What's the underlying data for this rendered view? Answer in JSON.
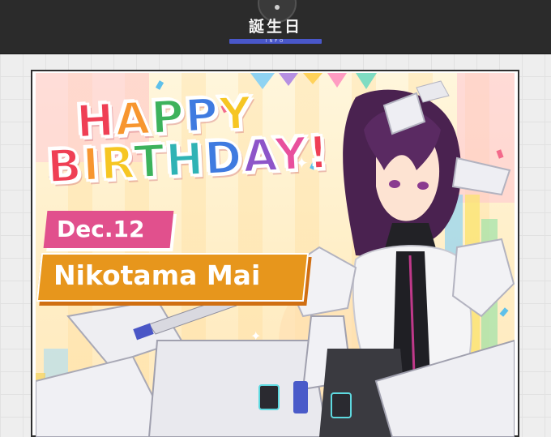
{
  "header": {
    "title": "誕生日",
    "subtitle": "INFO"
  },
  "banner": {
    "headline_line1": [
      "H",
      "A",
      "P",
      "P",
      "Y"
    ],
    "headline_line2": [
      "B",
      "I",
      "R",
      "T",
      "H",
      "D",
      "A",
      "Y",
      "!"
    ],
    "date": "Dec.12",
    "name": "Nikotama Mai"
  },
  "colors": {
    "header_bg": "#2b2b2b",
    "accent_blue": "#4957c9",
    "date_tag": "#e1508d",
    "name_tag": "#e7961c"
  },
  "icons": {
    "header_icon": "info-icon"
  }
}
